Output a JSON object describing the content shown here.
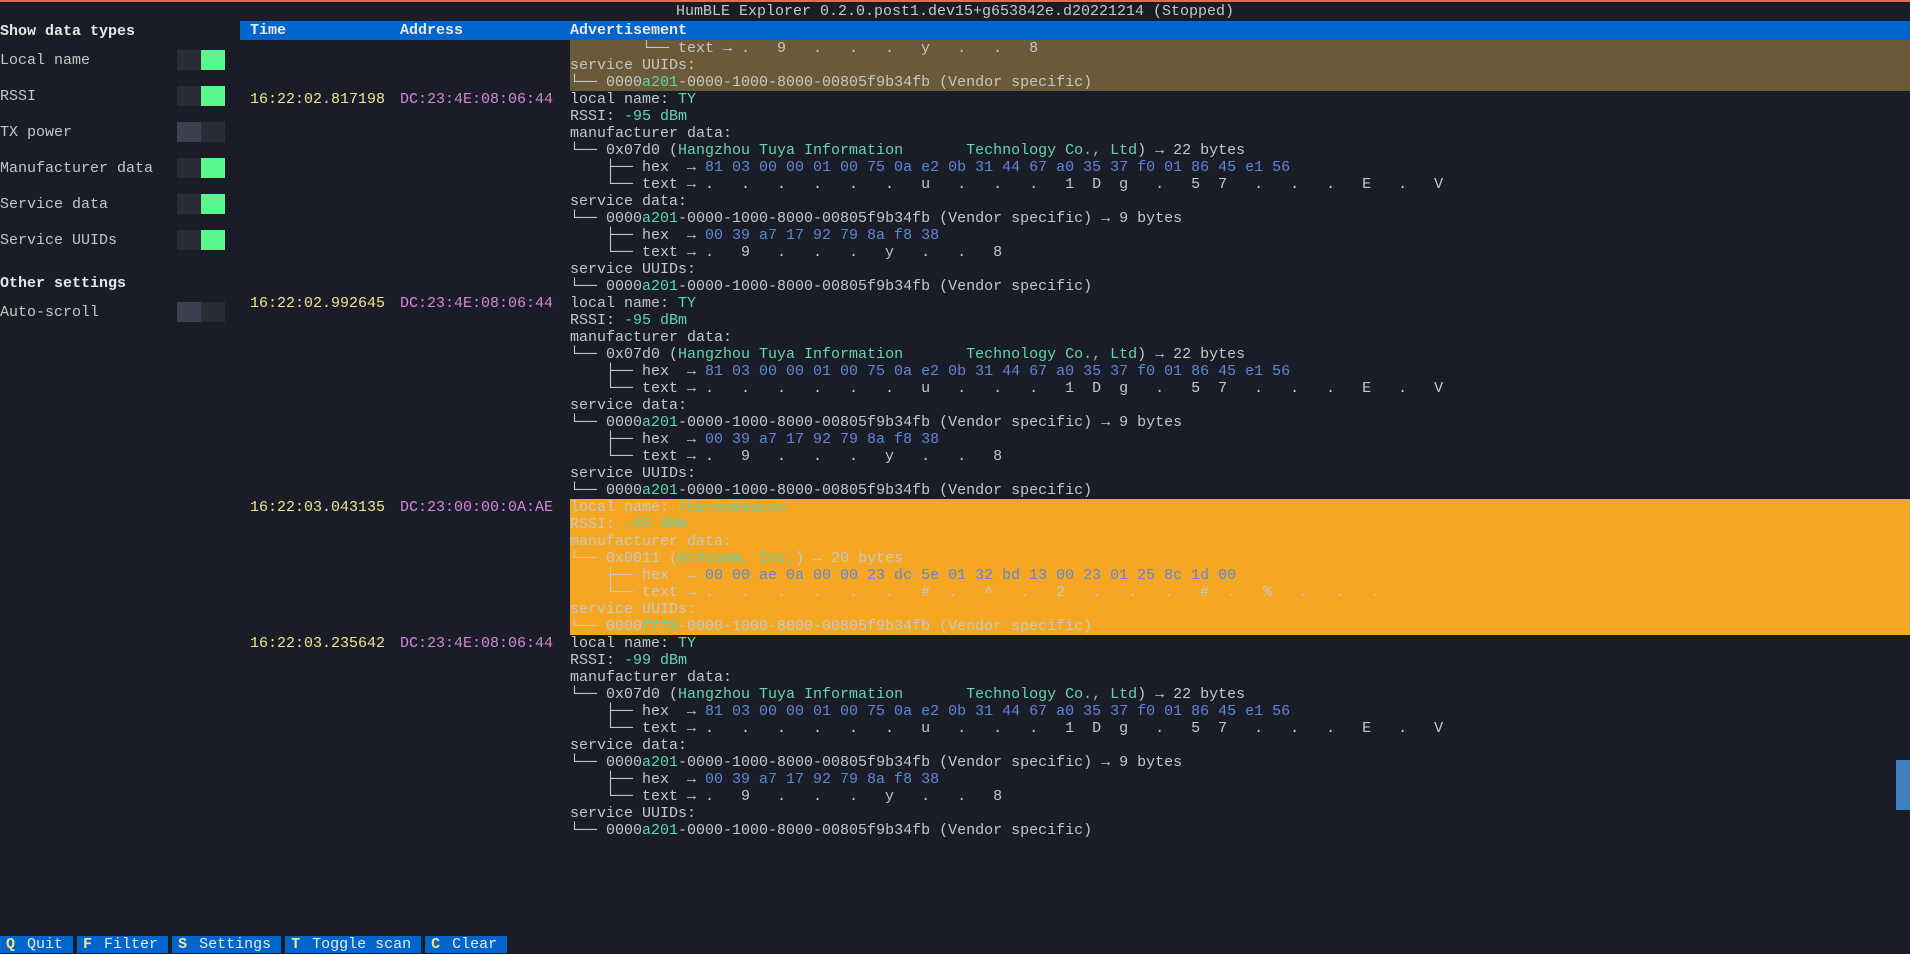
{
  "title": "HumBLE Explorer 0.2.0.post1.dev15+g653842e.d20221214 (Stopped)",
  "sidebar": {
    "section1_title": "Show data types",
    "section2_title": "Other settings",
    "items": [
      {
        "label": "Local name",
        "on": true
      },
      {
        "label": "RSSI",
        "on": true
      },
      {
        "label": "TX power",
        "on": false
      },
      {
        "label": "Manufacturer data",
        "on": true
      },
      {
        "label": "Service data",
        "on": true
      },
      {
        "label": "Service UUIDs",
        "on": true
      }
    ],
    "other": [
      {
        "label": "Auto-scroll",
        "on": false
      }
    ]
  },
  "headers": {
    "time": "Time",
    "address": "Address",
    "adv": "Advertisement"
  },
  "tree": {
    "branch_t": "├── ",
    "branch_l": "└── ",
    "arrow": " → "
  },
  "partial_top": {
    "text_line": "        └── text → .   9   .   .   .   y   .   .   8",
    "suuids_label": "service UUIDs:",
    "uuid_prefix": "└── 0000",
    "uuid_mid": "a201",
    "uuid_suffix": "-0000-1000-8000-00805f9b34fb (Vendor specific)"
  },
  "ty_entry": {
    "local_name_label": "local name: ",
    "local_name_value": "TY",
    "rssi_label": "RSSI: ",
    "mfr_label": "manufacturer data:",
    "mfr_id": "└── 0x07d0 (",
    "mfr_name1": "Hangzhou Tuya Information",
    "mfr_name2": "Technology Co., Ltd",
    "mfr_bytes": ") → 22 bytes",
    "hex_label": "    ├── hex  → ",
    "hex_value": "81 03 00 00 01 00 75 0a e2 0b 31 44 67 a0 35 37 f0 01 86 45 e1 56",
    "text_label": "    └── text → ",
    "text_value": ".   .   .   .   .   .   u   .   .   .   1  D  g   .   5  7   .   .   .   E   .   V",
    "sdata_label": "service data:",
    "sdata_uuid_prefix": "└── 0000",
    "sdata_uuid_mid": "a201",
    "sdata_uuid_suffix": "-0000-1000-8000-00805f9b34fb (Vendor specific) → 9 bytes",
    "sd_hex_label": "    ├── hex  → ",
    "sd_hex_value": "00 39 a7 17 92 79 8a f8 38",
    "sd_text_label": "    └── text → ",
    "sd_text_value": ".   9   .   .   .   y   .   .   8",
    "suuids_label": "service UUIDs:",
    "suuid_prefix": "└── 0000",
    "suuid_mid": "a201",
    "suuid_suffix": "-0000-1000-8000-00805f9b34fb (Vendor specific)"
  },
  "thermo": {
    "local_name_label": "local name: ",
    "local_name_value": "ThermoBeacon",
    "rssi_label": "RSSI: ",
    "rssi_value": "-85 dBm",
    "mfr_label": "manufacturer data:",
    "mfr_id": "└── 0x0011 (",
    "mfr_name": "Widcomm, Inc.",
    "mfr_bytes": ") → 20 bytes",
    "hex_label": "    ├── hex  → ",
    "hex_value": "00 00 ae 0a 00 00 23 dc 5e 01 32 bd 13 00 23 01 25 8c 1d 00",
    "text_label": "    └── text → ",
    "text_value": ".   .   .   .   .   .   #  .   ^   .   2   .   .   .   #  .   %   .   .   .",
    "suuids_label": "service UUIDs:",
    "suuid_prefix": "└── 0000",
    "suuid_mid": "fff0",
    "suuid_suffix": "-0000-1000-8000-00805f9b34fb (Vendor specific)"
  },
  "entries": [
    {
      "time": "16:22:02.817198",
      "addr": "DC:23:4E:08:06:44",
      "rssi": "-95 dBm",
      "type": "ty"
    },
    {
      "time": "16:22:02.992645",
      "addr": "DC:23:4E:08:06:44",
      "rssi": "-95 dBm",
      "type": "ty"
    },
    {
      "time": "16:22:03.043135",
      "addr": "DC:23:00:00:0A:AE",
      "type": "thermo"
    },
    {
      "time": "16:22:03.235642",
      "addr": "DC:23:4E:08:06:44",
      "rssi": "-99 dBm",
      "type": "ty"
    }
  ],
  "footer": [
    {
      "key": "Q",
      "label": "Quit"
    },
    {
      "key": "F",
      "label": "Filter"
    },
    {
      "key": "S",
      "label": "Settings"
    },
    {
      "key": "T",
      "label": "Toggle scan"
    },
    {
      "key": "C",
      "label": "Clear"
    }
  ]
}
